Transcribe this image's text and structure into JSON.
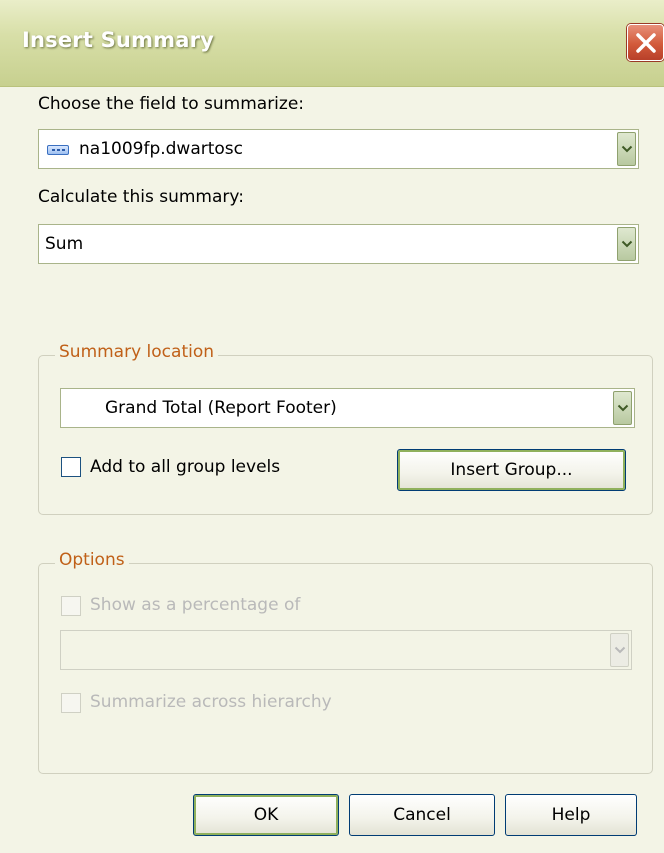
{
  "window": {
    "title": "Insert Summary",
    "close_icon": "close-icon"
  },
  "field_section": {
    "label": "Choose the field to summarize:",
    "selected_value": "na1009fp.dwartosc",
    "field_icon": "database-field-icon"
  },
  "summary_section": {
    "label": "Calculate this summary:",
    "selected_value": "Sum"
  },
  "location_group": {
    "legend": "Summary location",
    "selected_value": "Grand Total (Report Footer)",
    "add_all_levels_label": "Add to all group levels",
    "add_all_levels_checked": false,
    "insert_group_label": "Insert Group..."
  },
  "options_group": {
    "legend": "Options",
    "show_percentage_label": "Show as a percentage of",
    "show_percentage_checked": false,
    "percentage_value": "",
    "summarize_hierarchy_label": "Summarize across hierarchy",
    "summarize_hierarchy_checked": false,
    "disabled": true
  },
  "buttons": {
    "ok": "OK",
    "cancel": "Cancel",
    "help": "Help"
  },
  "colors": {
    "title_text": "#ffffff",
    "legend_active": "#c06018",
    "legend_disabled": "#d89a6a",
    "disabled_text": "#b9b9b9",
    "client_bg": "#f3f4e6",
    "close_button": "#d25a3a"
  }
}
